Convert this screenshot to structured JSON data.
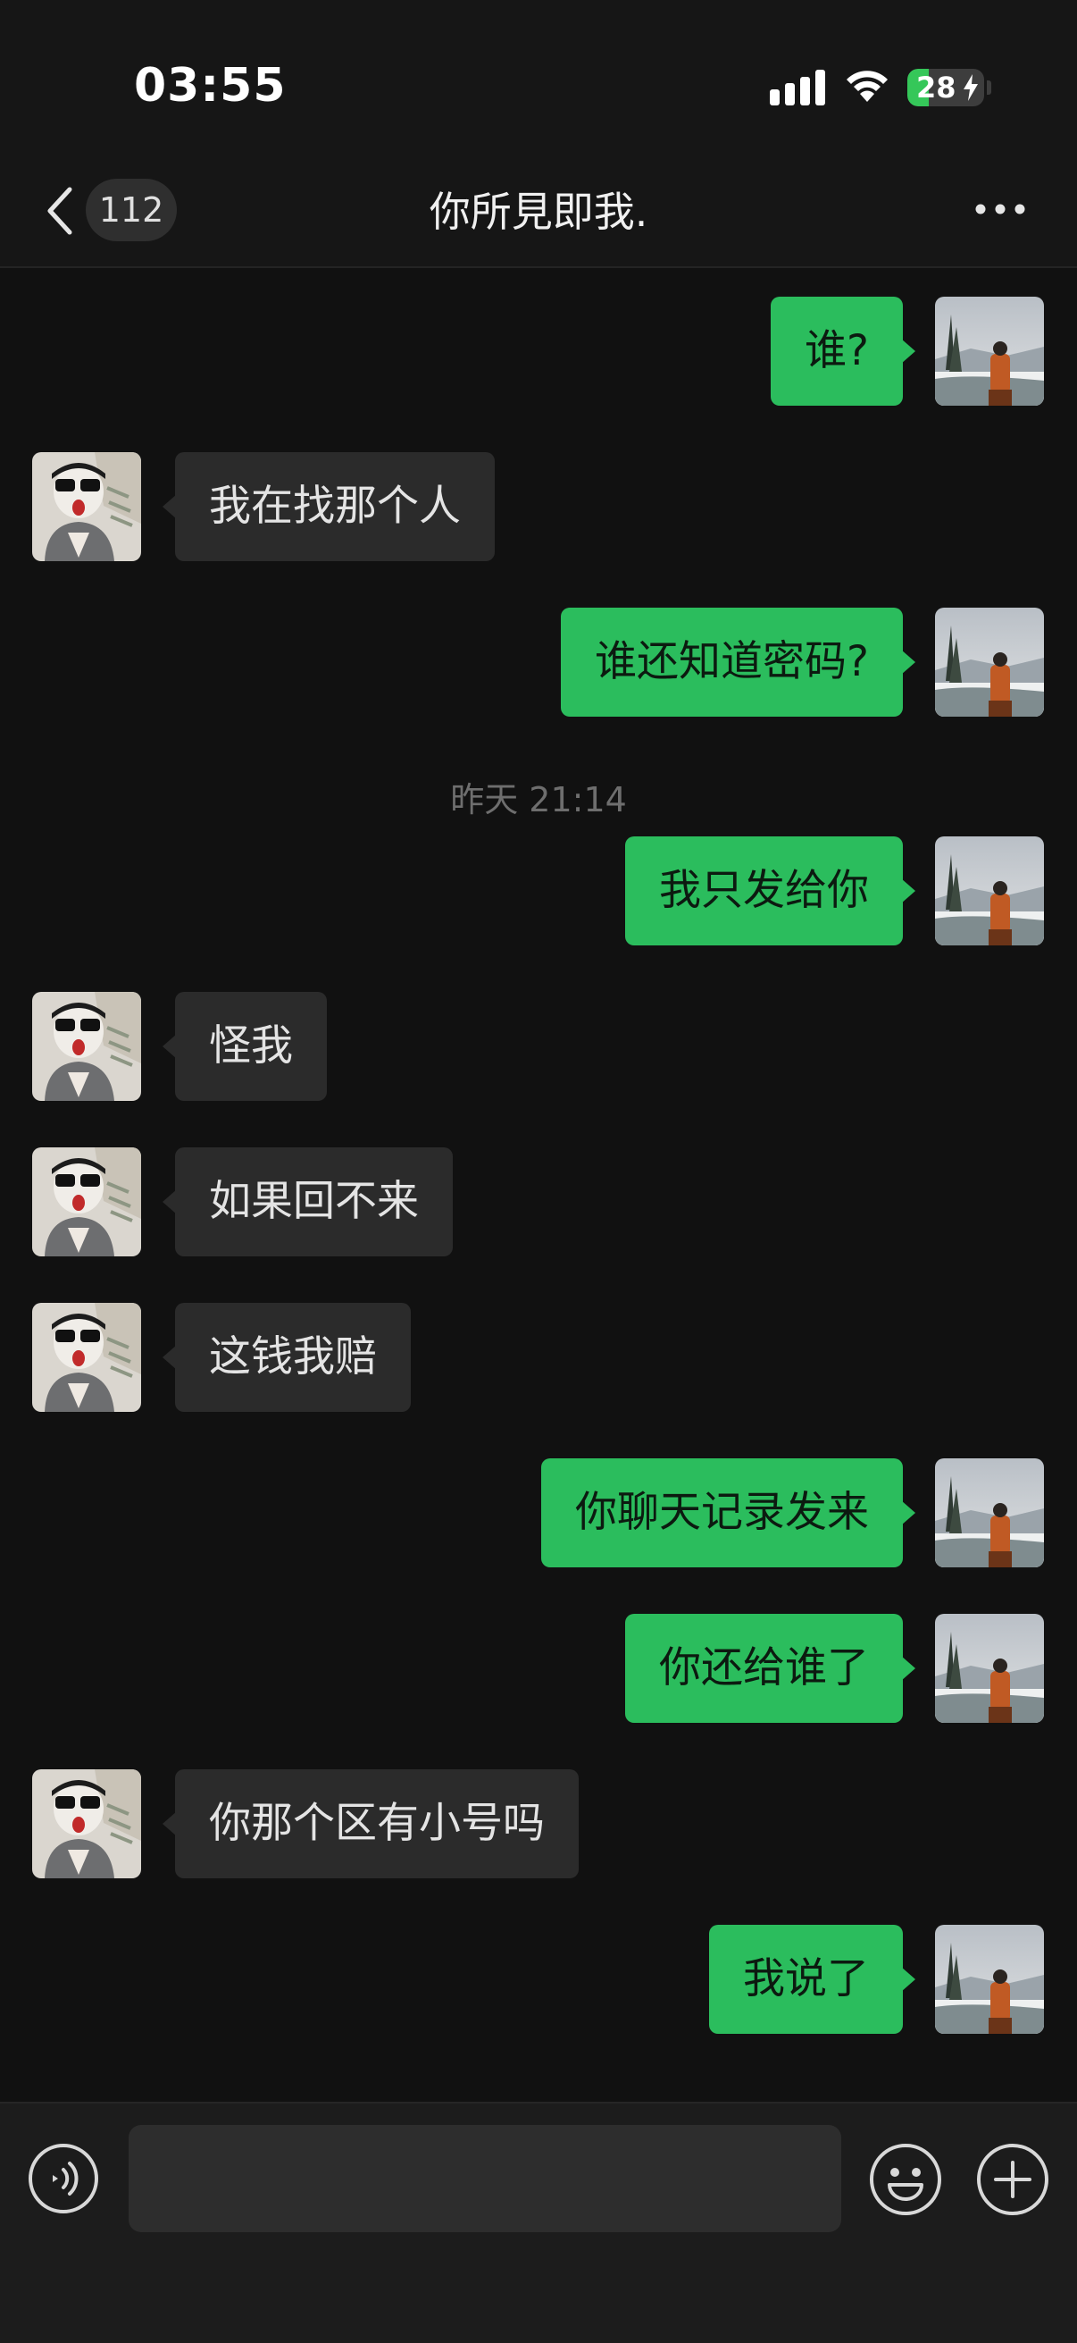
{
  "status_bar": {
    "time": "03:55",
    "battery_percent": "28",
    "battery_level": 0.28,
    "icons": [
      "signal-bars-icon",
      "wifi-icon",
      "battery-charging-icon"
    ]
  },
  "nav": {
    "back_icon": "chevron-left-icon",
    "unread_count": "112",
    "title": "你所見即我.",
    "more_icon": "more-dots-icon"
  },
  "messages": [
    {
      "sender": "me",
      "text": "谁?"
    },
    {
      "sender": "them",
      "text": "我在找那个人"
    },
    {
      "sender": "me",
      "text": "谁还知道密码?"
    },
    {
      "type": "timestamp",
      "text": "昨天 21:14"
    },
    {
      "sender": "me",
      "text": "我只发给你"
    },
    {
      "sender": "them",
      "text": "怪我"
    },
    {
      "sender": "them",
      "text": "如果回不来"
    },
    {
      "sender": "them",
      "text": "这钱我赔"
    },
    {
      "sender": "me",
      "text": "你聊天记录发来"
    },
    {
      "sender": "me",
      "text": "你还给谁了"
    },
    {
      "sender": "them",
      "text": "你那个区有小号吗"
    },
    {
      "sender": "me",
      "text": "我说了"
    }
  ],
  "input_bar": {
    "voice_icon": "voice-icon",
    "message_value": "",
    "emoji_icon": "emoji-icon",
    "plus_icon": "plus-icon"
  },
  "colors": {
    "background": "#111111",
    "bubble_me": "#2bbd5d",
    "bubble_them": "#2b2b2b",
    "battery_fill": "#35c759"
  }
}
